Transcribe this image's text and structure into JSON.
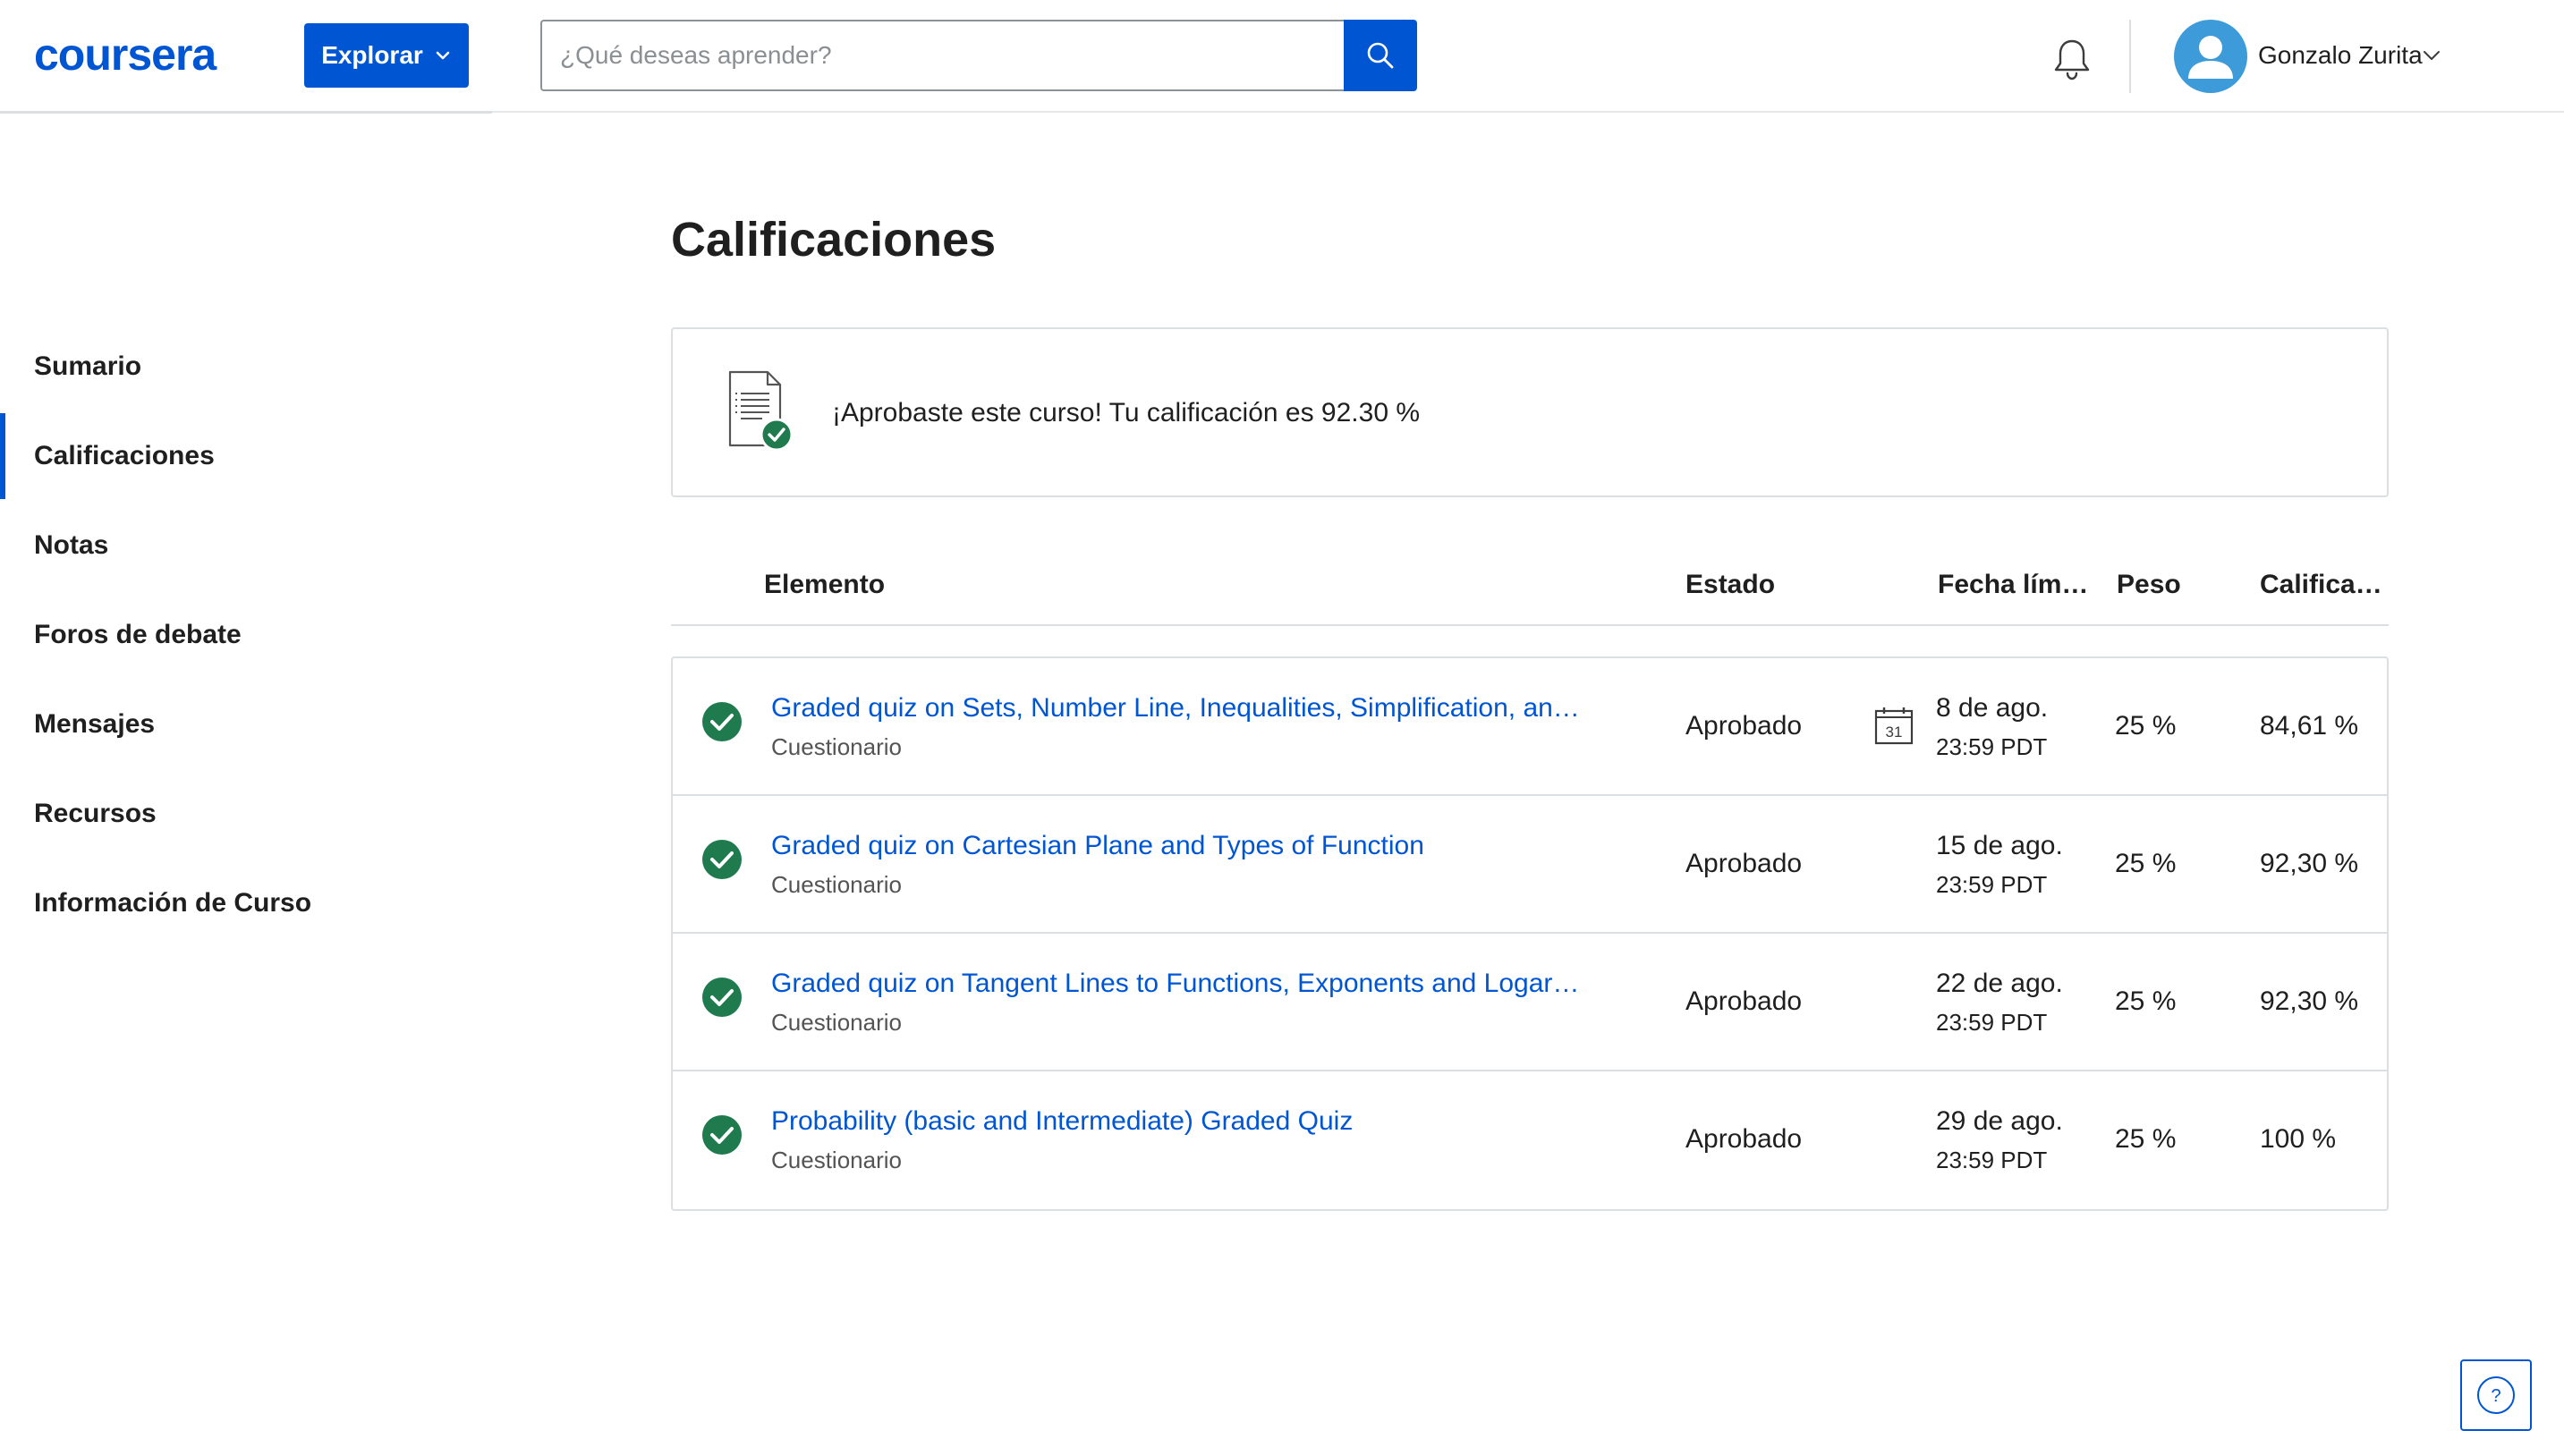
{
  "header": {
    "logo_text": "coursera",
    "explore_label": "Explorar",
    "search_placeholder": "¿Qué deseas aprender?",
    "user_name": "Gonzalo Zurita"
  },
  "sidebar": {
    "items": [
      {
        "label": "Sumario"
      },
      {
        "label": "Calificaciones"
      },
      {
        "label": "Notas"
      },
      {
        "label": "Foros de debate"
      },
      {
        "label": "Mensajes"
      },
      {
        "label": "Recursos"
      },
      {
        "label": "Información de Curso"
      }
    ],
    "active_index": 1
  },
  "main": {
    "title": "Calificaciones",
    "pass_message": "¡Aprobaste este curso! Tu calificación es 92.30 %",
    "columns": {
      "item": "Elemento",
      "status": "Estado",
      "due": "Fecha lím…",
      "weight": "Peso",
      "grade": "Califica…"
    },
    "rows": [
      {
        "title": "Graded quiz on Sets, Number Line, Inequalities, Simplification, an…",
        "type": "Cuestionario",
        "status": "Aprobado",
        "calendar_day": "31",
        "date": "8 de ago.",
        "time": "23:59 PDT",
        "weight": "25 %",
        "grade": "84,61 %"
      },
      {
        "title": "Graded quiz on Cartesian Plane and Types of Function",
        "type": "Cuestionario",
        "status": "Aprobado",
        "date": "15 de ago.",
        "time": "23:59 PDT",
        "weight": "25 %",
        "grade": "92,30 %"
      },
      {
        "title": "Graded quiz on Tangent Lines to Functions, Exponents and Logarit…",
        "type": "Cuestionario",
        "status": "Aprobado",
        "date": "22 de ago.",
        "time": "23:59 PDT",
        "weight": "25 %",
        "grade": "92,30 %"
      },
      {
        "title": "Probability (basic and Intermediate) Graded Quiz",
        "type": "Cuestionario",
        "status": "Aprobado",
        "date": "29 de ago.",
        "time": "23:59 PDT",
        "weight": "25 %",
        "grade": "100 %"
      }
    ]
  },
  "help": {
    "glyph": "?"
  },
  "colors": {
    "brand": "#0056d2",
    "success": "#1f7a4d",
    "avatar": "#3d9bd9",
    "border": "#dcdfe1"
  }
}
